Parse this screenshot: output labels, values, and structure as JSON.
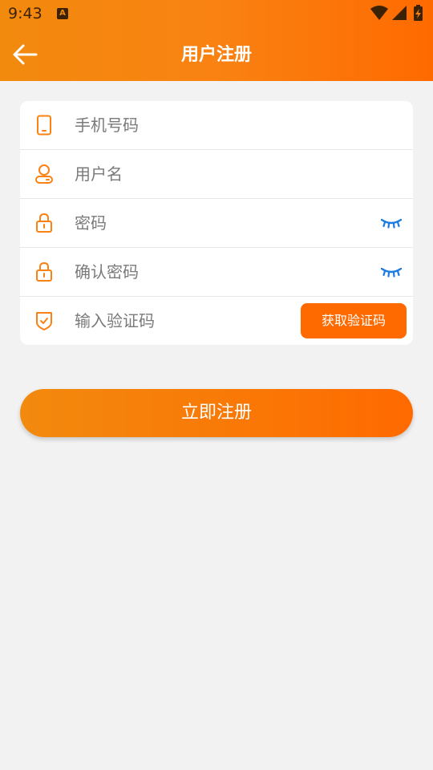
{
  "status_bar": {
    "time": "9:43",
    "notification_letter": "A"
  },
  "header": {
    "title": "用户注册"
  },
  "form": {
    "phone_placeholder": "手机号码",
    "username_placeholder": "用户名",
    "password_placeholder": "密码",
    "confirm_password_placeholder": "确认密码",
    "code_placeholder": "输入验证码",
    "get_code_label": "获取验证码"
  },
  "submit_label": "立即注册",
  "colors": {
    "accent": "#ff6a00",
    "accent_light": "#f28a0e",
    "eye_icon": "#1e7be0",
    "background": "#f2f2f2"
  }
}
